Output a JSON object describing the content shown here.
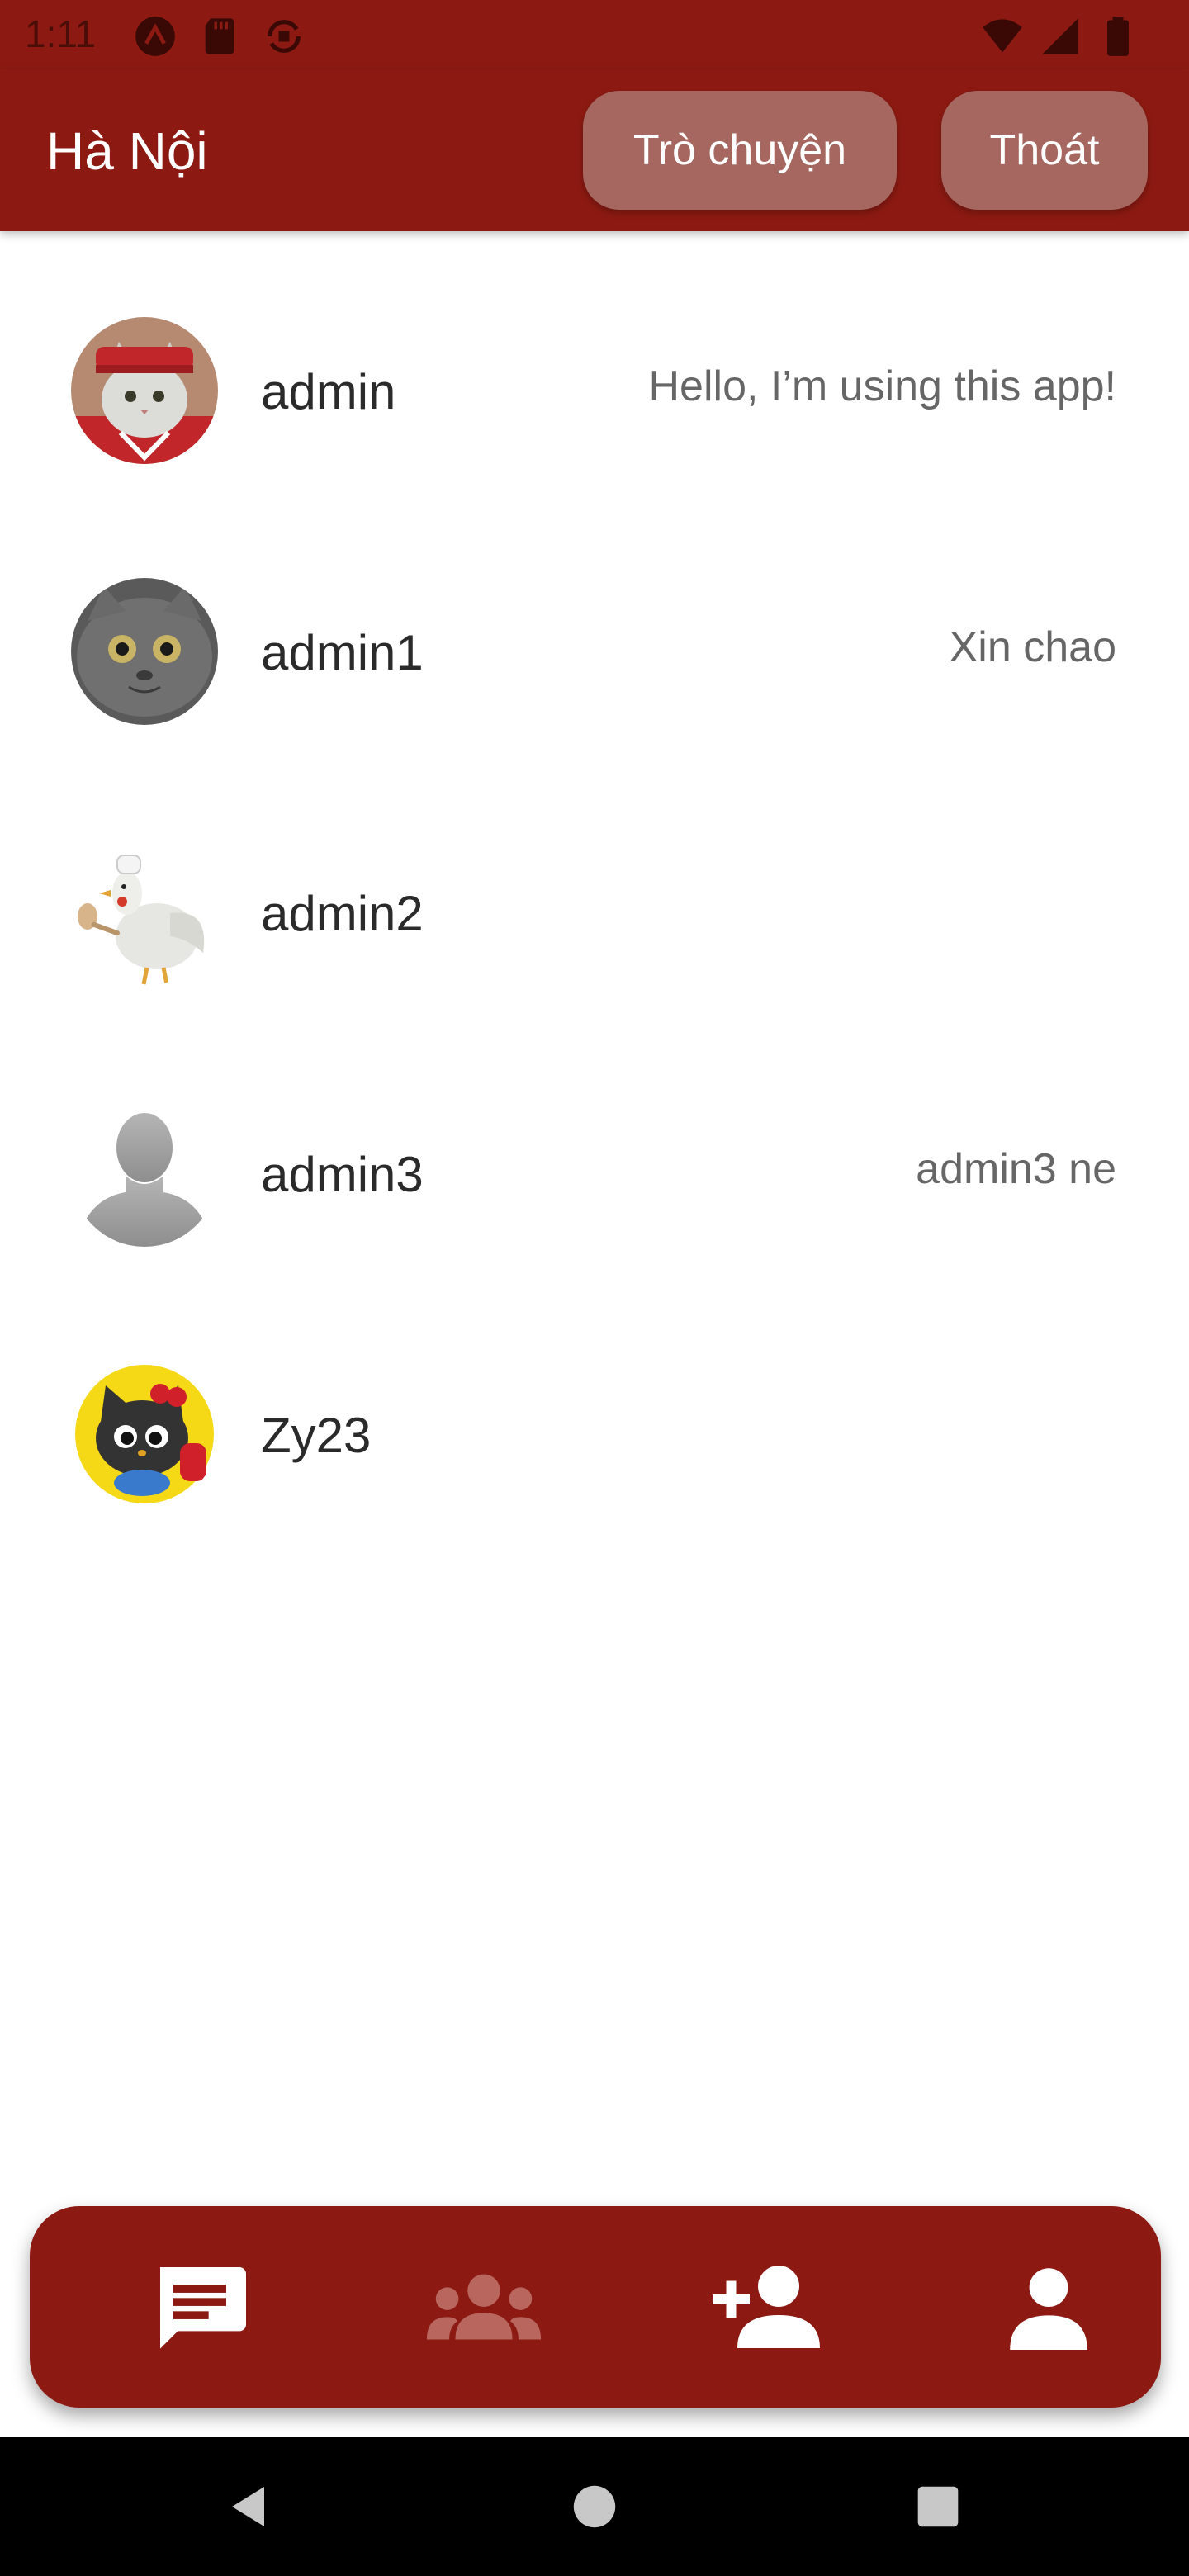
{
  "status_bar": {
    "time": "1:11",
    "icons_left": [
      "android-circle-icon",
      "sd-card-icon",
      "sync-icon"
    ],
    "icons_right": [
      "wifi-icon",
      "signal-icon",
      "battery-icon"
    ]
  },
  "app_bar": {
    "title": "Hà Nội",
    "chat_button": "Trò chuyện",
    "exit_button": "Thoát",
    "color": "#8c1a12",
    "button_color": "#a5675f"
  },
  "users": [
    {
      "name": "admin",
      "status": "Hello, I’m using this app!",
      "avatar": "cat-red-outfit-avatar"
    },
    {
      "name": "admin1",
      "status": "Xin chao",
      "avatar": "grey-cat-avatar"
    },
    {
      "name": "admin2",
      "status": "",
      "avatar": "chicken-chef-avatar"
    },
    {
      "name": "admin3",
      "status": "admin3 ne",
      "avatar": "default-person-avatar"
    },
    {
      "name": "Zy23",
      "status": "",
      "avatar": "black-cat-yellow-avatar"
    }
  ],
  "bottom_nav": {
    "items": [
      {
        "icon": "chat-icon",
        "active": true
      },
      {
        "icon": "groups-icon",
        "active": false
      },
      {
        "icon": "add-friend-icon",
        "active": false
      },
      {
        "icon": "profile-icon",
        "active": false
      }
    ]
  },
  "system_nav": {
    "icons": [
      "back-icon",
      "home-icon",
      "recents-icon"
    ]
  }
}
